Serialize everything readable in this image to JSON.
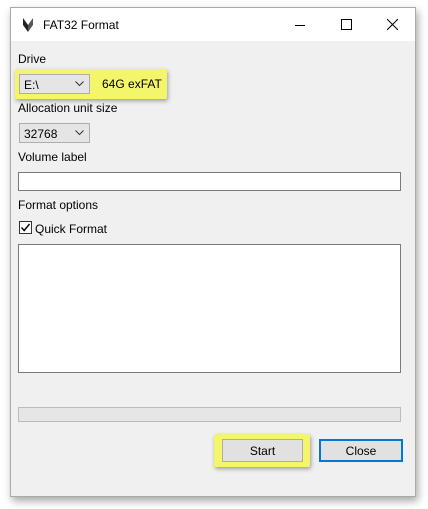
{
  "window": {
    "title": "FAT32 Format",
    "controls": {
      "minimize": "minimize-icon",
      "maximize": "maximize-icon",
      "close": "close-icon"
    }
  },
  "drive": {
    "label": "Drive",
    "selected": "E:\\",
    "annotation": "64G exFAT"
  },
  "allocation": {
    "label": "Allocation unit size",
    "selected": "32768"
  },
  "volume": {
    "label": "Volume label",
    "value": ""
  },
  "format_options": {
    "label": "Format options",
    "quick_format": {
      "label": "Quick Format",
      "checked": true
    }
  },
  "log": {
    "text": ""
  },
  "progress": {
    "value": 0
  },
  "buttons": {
    "start": "Start",
    "close": "Close"
  },
  "colors": {
    "highlight": "#f3f56a",
    "accent": "#0078d7"
  }
}
